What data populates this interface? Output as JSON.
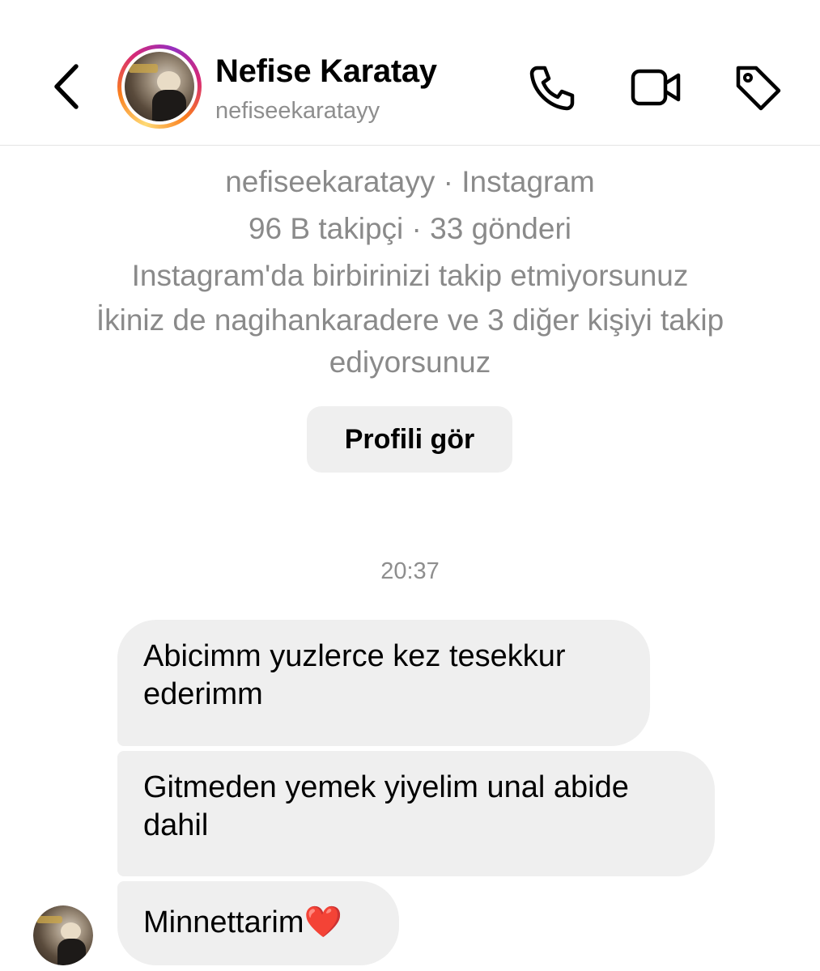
{
  "header": {
    "name": "Nefise Karatay",
    "username": "nefiseekaratayy",
    "ring_colors": [
      "#feda75",
      "#fa7e1e",
      "#d62976",
      "#962fbf"
    ]
  },
  "profile_card": {
    "source": "nefiseekaratayy · Instagram",
    "stats": "96 B takipçi · 33 gönderi",
    "follow_status": "Instagram'da birbirinizi takip etmiyorsunuz",
    "mutuals": "İkiniz de nagihankaradere ve 3 diğer kişiyi takip ediyorsunuz",
    "view_profile_label": "Profili gör"
  },
  "chat": {
    "timestamp": "20:37",
    "messages": [
      {
        "text": "Abicimm yuzlerce kez tesekkur ederimm"
      },
      {
        "text": "Gitmeden yemek yiyelim unal abide dahil"
      },
      {
        "text": "Minnettarim",
        "emoji": "❤️"
      }
    ]
  },
  "icons": {
    "back": "chevron-left-icon",
    "phone": "phone-icon",
    "video": "video-camera-icon",
    "tag": "tag-icon"
  }
}
